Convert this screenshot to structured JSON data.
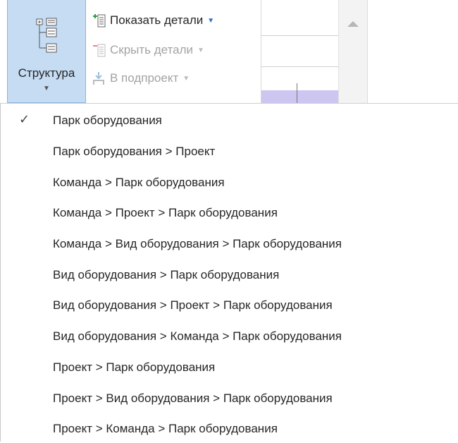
{
  "ribbon": {
    "structure_button": {
      "label": "Структура"
    },
    "show_details": {
      "label": "Показать детали"
    },
    "hide_details": {
      "label": "Скрыть детали"
    },
    "to_subproject": {
      "label": "В подпроект"
    }
  },
  "menu": {
    "selected_index": 0,
    "items": [
      {
        "label": "Парк оборудования",
        "checked": true
      },
      {
        "label": "Парк оборудования > Проект",
        "checked": false
      },
      {
        "label": "Команда > Парк оборудования",
        "checked": false
      },
      {
        "label": "Команда > Проект > Парк оборудования",
        "checked": false
      },
      {
        "label": "Команда > Вид оборудования > Парк оборудования",
        "checked": false
      },
      {
        "label": "Вид оборудования > Парк оборудования",
        "checked": false
      },
      {
        "label": "Вид оборудования > Проект > Парк оборудования",
        "checked": false
      },
      {
        "label": "Вид оборудования > Команда > Парк оборудования",
        "checked": false
      },
      {
        "label": "Проект > Парк оборудования",
        "checked": false
      },
      {
        "label": "Проект > Вид оборудования > Парк оборудования",
        "checked": false
      },
      {
        "label": "Проект > Команда > Парк оборудования",
        "checked": false
      }
    ]
  },
  "colors": {
    "accent": "#c5dcf3",
    "accent_border": "#8cb3dd",
    "icon_blue": "#2b6fbd",
    "icon_green": "#2e9b45",
    "icon_red": "#d7473f",
    "disabled_text": "#a3a3a3",
    "gantt_bar": "#ccc6f0"
  }
}
